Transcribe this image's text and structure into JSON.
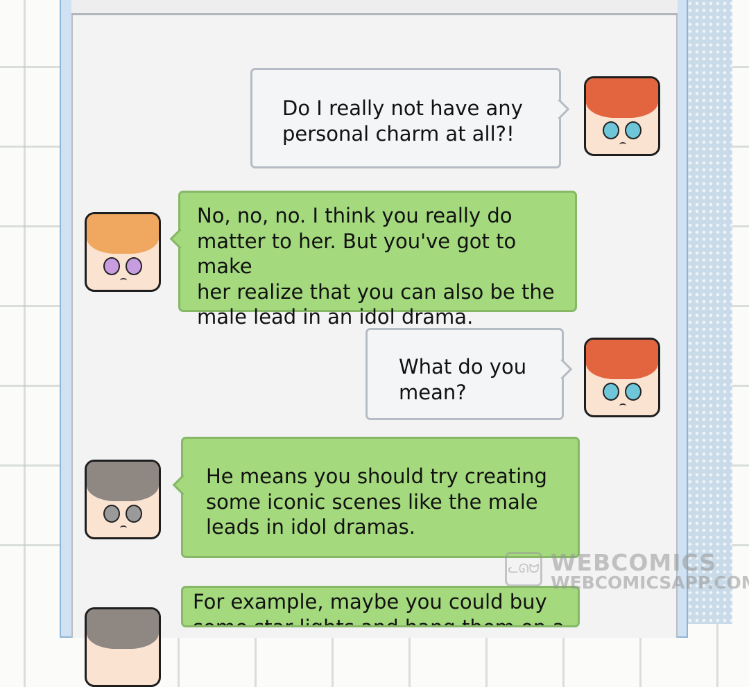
{
  "messages": [
    {
      "id": 1,
      "side": "right",
      "style": "white",
      "avatar": "red-haired-boy-avatar",
      "text": "Do I really not have any\npersonal charm at all?!"
    },
    {
      "id": 2,
      "side": "left",
      "style": "green",
      "avatar": "orange-haired-boy-avatar",
      "text": "No, no, no. I think you really do\nmatter to her. But you've got to make\nher realize that you can also be the\nmale lead in an idol drama."
    },
    {
      "id": 3,
      "side": "right",
      "style": "white",
      "avatar": "red-haired-boy-avatar",
      "text": "What do you\nmean?"
    },
    {
      "id": 4,
      "side": "left",
      "style": "green",
      "avatar": "brown-haired-boy-avatar",
      "text": "He means you should try creating\nsome iconic scenes like the male\nleads in idol dramas."
    },
    {
      "id": 5,
      "side": "left",
      "style": "green",
      "avatar": "brown-haired-boy-avatar",
      "text": "For example, maybe you could buy\nsome star lights and hang them on a"
    }
  ],
  "watermark": {
    "line1": "WEBCOMICS",
    "line2": "WEBCOMICSAPP.COM",
    "logo_icon": "webcomics-cat-logo-icon"
  },
  "colors": {
    "green_bubble": "#a4d97e",
    "white_bubble": "#f4f5f6",
    "frame": "#cfe1f2"
  }
}
